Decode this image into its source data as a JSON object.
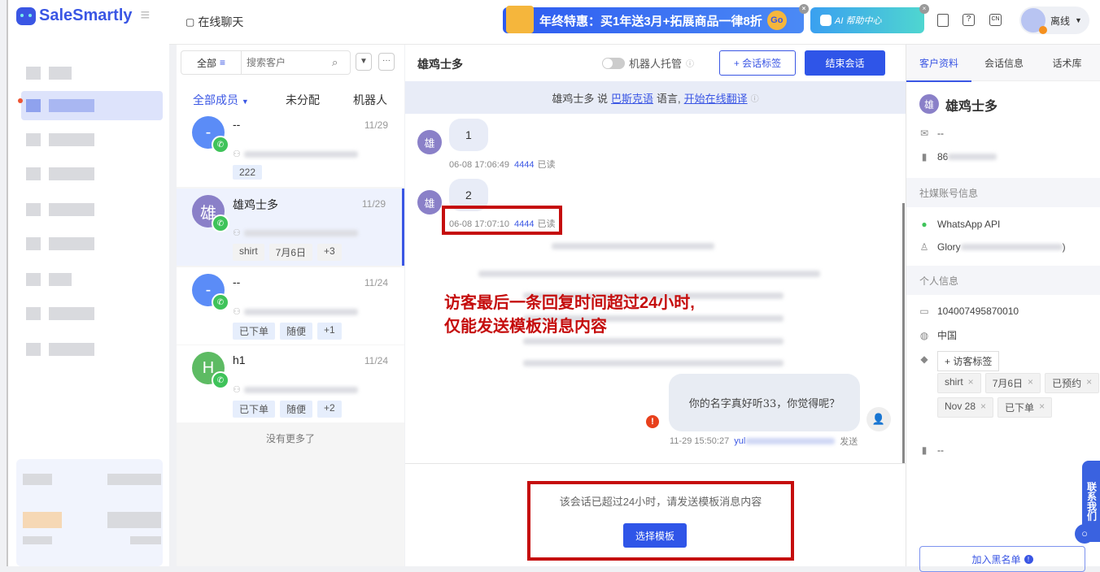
{
  "brand": {
    "name": "SaleSmartly"
  },
  "header": {
    "section_title": "在线聊天",
    "promo_banner": "年终特惠：买1年送3月+拓展商品一律8折",
    "promo_go": "Go",
    "ai_banner": "AI 帮助中心",
    "status": "离线",
    "lang_badge": "CN"
  },
  "list": {
    "filter_all": "全部",
    "search_placeholder": "搜索客户",
    "tabs": [
      "全部成员",
      "未分配",
      "机器人"
    ],
    "conversations": [
      {
        "avatar": "-",
        "name": "--",
        "date": "11/29",
        "tags": [
          "222"
        ],
        "avatar_color": "#5b8cf7"
      },
      {
        "avatar": "雄",
        "name": "雄鸡士多",
        "date": "11/29",
        "tags": [
          "shirt",
          "7月6日",
          "+3"
        ],
        "avatar_color": "#8a80c8"
      },
      {
        "avatar": "-",
        "name": "--",
        "date": "11/24",
        "tags": [
          "已下单",
          "随便",
          "+1"
        ],
        "avatar_color": "#5b8cf7"
      },
      {
        "avatar": "H",
        "name": "h1",
        "date": "11/24",
        "tags": [
          "已下单",
          "随便",
          "+2"
        ],
        "avatar_color": "#5dbb63"
      }
    ],
    "no_more": "没有更多了"
  },
  "chat": {
    "title": "雄鸡士多",
    "robot_toggle": "机器人托管",
    "add_tag": "+ 会话标签",
    "end_button": "结束会话",
    "translate": {
      "prefix": "雄鸡士多 说",
      "language": "巴斯克语",
      "middle": "语言,",
      "action": "开始在线翻译"
    },
    "messages": [
      {
        "avatar": "雄",
        "text": "1",
        "time": "06-08 17:06:49",
        "agent": "4444",
        "status": "已读"
      },
      {
        "avatar": "雄",
        "text": "2",
        "time": "06-08 17:07:10",
        "agent": "4444",
        "status": "已读"
      }
    ],
    "outgoing": {
      "text": "你的名字真好听33，你觉得呢？",
      "time": "11-29 15:50:27",
      "agent_prefix": "yul",
      "status": "发送"
    },
    "annotation": [
      "访客最后一条回复时间超过24小时,",
      "仅能发送模板消息内容"
    ],
    "notice": "该会话已超过24小时，请发送模板消息内容",
    "template_button": "选择模板"
  },
  "right": {
    "tabs": [
      "客户资料",
      "会话信息",
      "话术库"
    ],
    "name": "雄鸡士多",
    "avatar": "雄",
    "email": "--",
    "phone_prefix": "86",
    "social_title": "社媒账号信息",
    "channel": "WhatsApp API",
    "account_prefix": "Glory",
    "account_suffix": ")",
    "personal_title": "个人信息",
    "id": "104007495870010",
    "country": "中国",
    "add_tag": "+ 访客标签",
    "tags": [
      "shirt",
      "7月6日",
      "已预约",
      "Nov 28",
      "已下单"
    ],
    "note": "--",
    "blacklist": "加入黑名单",
    "contact_us": "联系我们"
  },
  "colors": {
    "accent": "#3a56e4",
    "annotation_red": "#c50d0d"
  }
}
